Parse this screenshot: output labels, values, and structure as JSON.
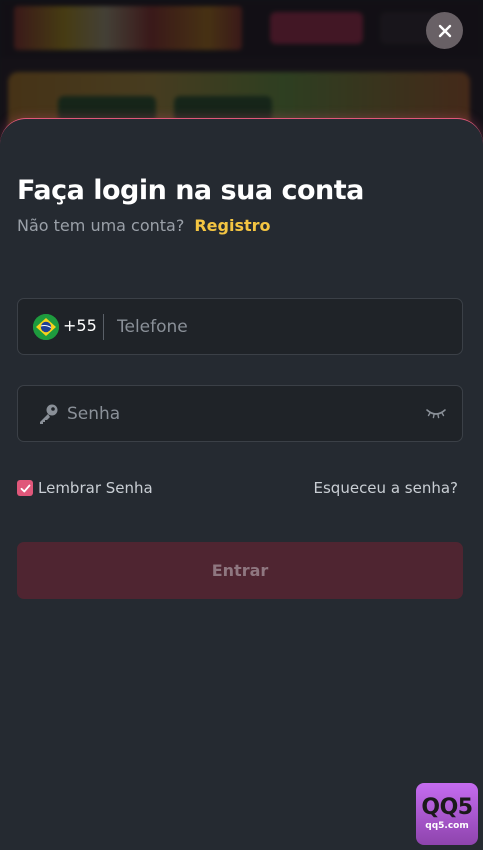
{
  "login": {
    "title": "Faça login na sua conta",
    "no_account_text": "Não tem uma conta?",
    "register_link": "Registro",
    "phone": {
      "flag_icon": "brazil-flag-icon",
      "dial_code": "+55",
      "placeholder": "Telefone",
      "value": ""
    },
    "password": {
      "icon": "key-icon",
      "placeholder": "Senha",
      "value": "",
      "toggle_icon": "eye-closed-icon"
    },
    "remember_label": "Lembrar Senha",
    "remember_checked": true,
    "forgot_link": "Esqueceu a senha?",
    "submit_label": "Entrar"
  },
  "watermark": {
    "big": "QQ5",
    "small": "qq5.com"
  },
  "colors": {
    "accent": "#e0577a",
    "link_yellow": "#f4c542",
    "sheet_bg": "#252a31",
    "field_bg": "#1f2328",
    "submit_bg": "#4f2531"
  }
}
